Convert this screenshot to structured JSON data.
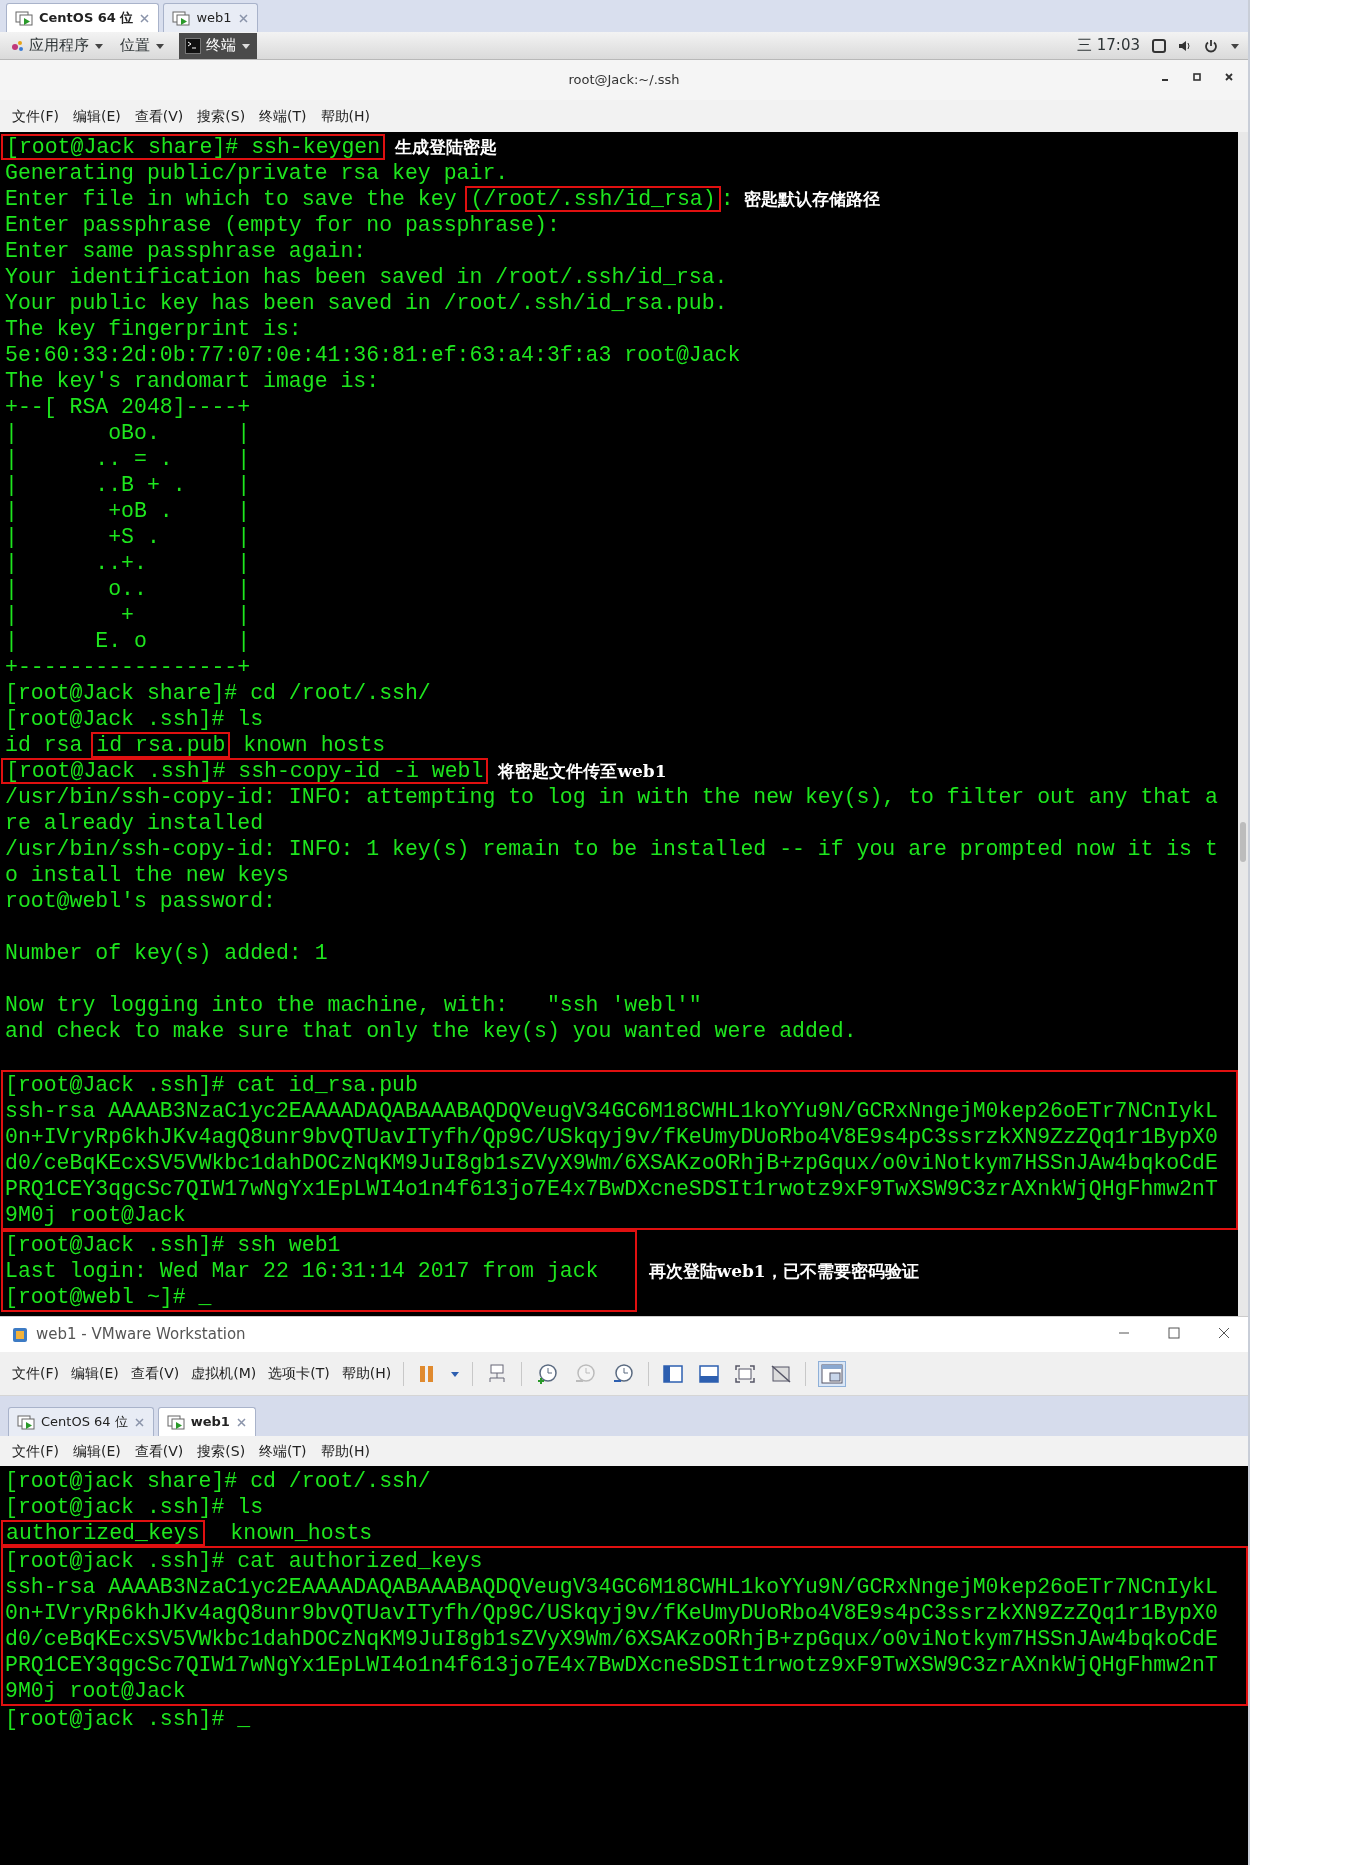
{
  "top_window": {
    "tabs": [
      {
        "label": "CentOS 64 位",
        "selected": true
      },
      {
        "label": "web1",
        "selected": false
      }
    ],
    "panel": {
      "menus": [
        "应用程序",
        "位置"
      ],
      "app": "终端",
      "clock": "三 17:03"
    },
    "title": "root@Jack:~/.ssh",
    "menu": [
      "文件(F)",
      "编辑(E)",
      "查看(V)",
      "搜索(S)",
      "终端(T)",
      "帮助(H)"
    ],
    "terminal": [
      {
        "kind": "line",
        "segments": [
          {
            "text": "[root@Jack share]# ssh-keygen",
            "boxed": true
          }
        ],
        "note": "生成登陆密匙"
      },
      {
        "kind": "line",
        "text": "Generating public/private rsa key pair."
      },
      {
        "kind": "line",
        "segments": [
          {
            "text": "Enter file in which to save the key ",
            "boxed": false
          },
          {
            "text": "(/root/.ssh/id_rsa)",
            "boxed": true
          },
          {
            "text": ":",
            "boxed": false
          }
        ],
        "note": "密匙默认存储路径"
      },
      {
        "kind": "line",
        "text": "Enter passphrase (empty for no passphrase):"
      },
      {
        "kind": "line",
        "text": "Enter same passphrase again:"
      },
      {
        "kind": "line",
        "text": "Your identification has been saved in /root/.ssh/id_rsa."
      },
      {
        "kind": "line",
        "text": "Your public key has been saved in /root/.ssh/id_rsa.pub."
      },
      {
        "kind": "line",
        "text": "The key fingerprint is:"
      },
      {
        "kind": "line",
        "text": "5e:60:33:2d:0b:77:07:0e:41:36:81:ef:63:a4:3f:a3 root@Jack"
      },
      {
        "kind": "line",
        "text": "The key's randomart image is:"
      },
      {
        "kind": "line",
        "text": "+--[ RSA 2048]----+"
      },
      {
        "kind": "line",
        "text": "|       oBo.      |"
      },
      {
        "kind": "line",
        "text": "|      .. = .     |"
      },
      {
        "kind": "line",
        "text": "|      ..B + .    |"
      },
      {
        "kind": "line",
        "text": "|       +oB .     |"
      },
      {
        "kind": "line",
        "text": "|       +S .      |"
      },
      {
        "kind": "line",
        "text": "|      ..+.       |"
      },
      {
        "kind": "line",
        "text": "|       o..       |"
      },
      {
        "kind": "line",
        "text": "|        +        |"
      },
      {
        "kind": "line",
        "text": "|      E. o       |"
      },
      {
        "kind": "line",
        "text": "+-----------------+"
      },
      {
        "kind": "line",
        "text": "[root@Jack share]# cd /root/.ssh/"
      },
      {
        "kind": "line",
        "text": "[root@Jack .ssh]# ls"
      },
      {
        "kind": "line",
        "segments": [
          {
            "text": "id rsa ",
            "boxed": false
          },
          {
            "text": "id rsa.pub",
            "boxed": true
          },
          {
            "text": " known hosts",
            "boxed": false
          }
        ]
      },
      {
        "kind": "line",
        "segments": [
          {
            "text": "[root@Jack .ssh]# ssh-copy-id -i webl",
            "boxed": true
          }
        ],
        "note": "将密匙文件传至web1"
      },
      {
        "kind": "line",
        "text": "/usr/bin/ssh-copy-id: INFO: attempting to log in with the new key(s), to filter out any that a"
      },
      {
        "kind": "line",
        "text": "re already installed"
      },
      {
        "kind": "line",
        "text": "/usr/bin/ssh-copy-id: INFO: 1 key(s) remain to be installed -- if you are prompted now it is t"
      },
      {
        "kind": "line",
        "text": "o install the new keys"
      },
      {
        "kind": "line",
        "text": "root@webl's password:"
      },
      {
        "kind": "blank"
      },
      {
        "kind": "line",
        "text": "Number of key(s) added: 1"
      },
      {
        "kind": "blank"
      },
      {
        "kind": "line",
        "text": "Now try logging into the machine, with:   \"ssh 'webl'\""
      },
      {
        "kind": "line",
        "text": "and check to make sure that only the key(s) you wanted were added."
      },
      {
        "kind": "blank"
      },
      {
        "kind": "group",
        "boxed": true,
        "lines": [
          "[root@Jack .ssh]# cat id_rsa.pub",
          "ssh-rsa AAAAB3NzaC1yc2EAAAADAQABAAABAQDQVeugV34GC6M18CWHL1koYYu9N/GCRxNngejM0kep26oETr7NCnIykL",
          "0n+IVryRp6khJKv4agQ8unr9bvQTUavITyfh/Qp9C/USkqyj9v/fKeUmyDUoRbo4V8E9s4pC3ssrzkXN9ZzZQq1r1BypX0",
          "d0/ceBqKEcxSV5VWkbc1dahDOCzNqKM9JuI8gb1sZVyX9Wm/6XSAKzoORhjB+zpGqux/o0viNotkym7HSSnJAw4bqkoCdE",
          "PRQ1CEY3qgcSc7QIW17wNgYx1EpLWI4o1n4f613jo7E4x7BwDXcneSDSIt1rwotz9xF9TwXSW9C3zrAXnkWjQHgFhmw2nT",
          "9M0j root@Jack"
        ]
      },
      {
        "kind": "group",
        "boxed": true,
        "lines": [
          "[root@Jack .ssh]# ssh web1",
          "Last login: Wed Mar 22 16:31:14 2017 from jack",
          "[root@webl ~]# _"
        ],
        "note": "再次登陆web1，已不需要密码验证"
      }
    ]
  },
  "vmware_window": {
    "title": "web1 - VMware Workstation",
    "menu": [
      "文件(F)",
      "编辑(E)",
      "查看(V)",
      "虚拟机(M)",
      "选项卡(T)",
      "帮助(H)"
    ],
    "tabs": [
      {
        "label": "CentOS 64 位",
        "selected": false
      },
      {
        "label": "web1",
        "selected": true
      }
    ],
    "terminal_menu": [
      "文件(F)",
      "编辑(E)",
      "查看(V)",
      "搜索(S)",
      "终端(T)",
      "帮助(H)"
    ],
    "terminal": [
      {
        "kind": "line",
        "text": "[root@jack share]# cd /root/.ssh/"
      },
      {
        "kind": "line",
        "text": "[root@jack .ssh]# ls"
      },
      {
        "kind": "line",
        "segments": [
          {
            "text": "authorized_keys",
            "boxed": true
          },
          {
            "text": "  known_hosts",
            "boxed": false
          }
        ]
      },
      {
        "kind": "group",
        "boxed": true,
        "lines": [
          "[root@jack .ssh]# cat authorized_keys",
          "ssh-rsa AAAAB3NzaC1yc2EAAAADAQABAAABAQDQVeugV34GC6M18CWHL1koYYu9N/GCRxNngejM0kep26oETr7NCnIykL",
          "0n+IVryRp6khJKv4agQ8unr9bvQTUavITyfh/Qp9C/USkqyj9v/fKeUmyDUoRbo4V8E9s4pC3ssrzkXN9ZzZQq1r1BypX0",
          "d0/ceBqKEcxSV5VWkbc1dahDOCzNqKM9JuI8gb1sZVyX9Wm/6XSAKzoORhjB+zpGqux/o0viNotkym7HSSnJAw4bqkoCdE",
          "PRQ1CEY3qgcSc7QIW17wNgYx1EpLWI4o1n4f613jo7E4x7BwDXcneSDSIt1rwotz9xF9TwXSW9C3zrAXnkWjQHgFhmw2nT",
          "9M0j root@Jack"
        ]
      },
      {
        "kind": "line",
        "text": "[root@jack .ssh]# _"
      }
    ]
  }
}
